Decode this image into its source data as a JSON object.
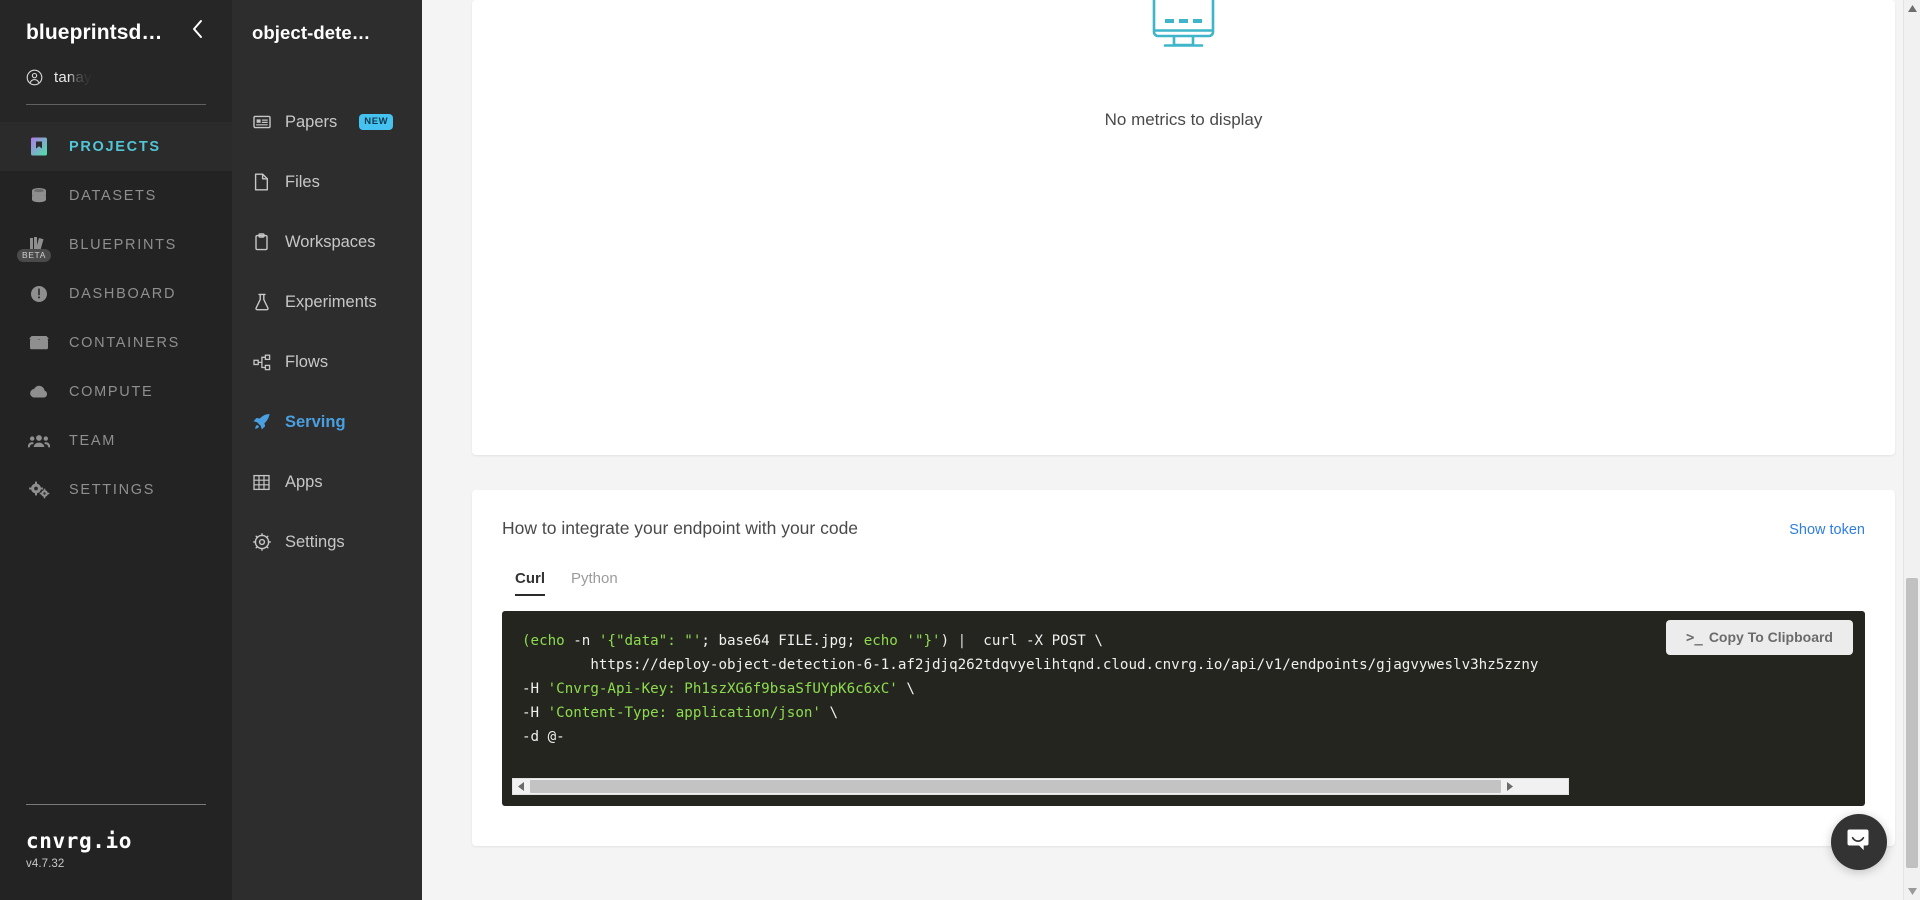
{
  "sidebar": {
    "org_name": "blueprintsd…",
    "collapse_icon": "chevron-left-icon",
    "user_name": "tanay.",
    "items": [
      {
        "label": "PROJECTS",
        "icon": "projects-icon",
        "active": true
      },
      {
        "label": "DATASETS",
        "icon": "datasets-icon",
        "active": false
      },
      {
        "label": "BLUEPRINTS",
        "icon": "blueprints-icon",
        "active": false,
        "badge": "BETA"
      },
      {
        "label": "DASHBOARD",
        "icon": "dashboard-icon",
        "active": false
      },
      {
        "label": "CONTAINERS",
        "icon": "containers-icon",
        "active": false
      },
      {
        "label": "COMPUTE",
        "icon": "compute-icon",
        "active": false
      },
      {
        "label": "TEAM",
        "icon": "team-icon",
        "active": false
      },
      {
        "label": "SETTINGS",
        "icon": "settings-icon",
        "active": false
      }
    ],
    "brand_name": "cnvrg.io",
    "brand_version": "v4.7.32",
    "accent_active": "#52c5d6"
  },
  "project_nav": {
    "title": "object-dete…",
    "items": [
      {
        "label": "Papers",
        "icon": "papers-icon",
        "active": false,
        "badge": "NEW"
      },
      {
        "label": "Files",
        "icon": "file-icon",
        "active": false
      },
      {
        "label": "Workspaces",
        "icon": "clipboard-icon",
        "active": false
      },
      {
        "label": "Experiments",
        "icon": "flask-icon",
        "active": false
      },
      {
        "label": "Flows",
        "icon": "flow-icon",
        "active": false
      },
      {
        "label": "Serving",
        "icon": "rocket-icon",
        "active": true
      },
      {
        "label": "Apps",
        "icon": "grid-icon",
        "active": false
      },
      {
        "label": "Settings",
        "icon": "gear-icon",
        "active": false
      }
    ],
    "accent_active": "#4a9fe0"
  },
  "metrics": {
    "empty_icon": "monitor-chart-icon",
    "empty_text": "No metrics to display",
    "icon_color": "#3eb5c9"
  },
  "integrate": {
    "title": "How to integrate your endpoint with your code",
    "show_token_label": "Show token",
    "show_token_color": "#2f7ee0",
    "tabs": [
      {
        "label": "Curl",
        "active": true
      },
      {
        "label": "Python",
        "active": false
      }
    ],
    "copy_button": {
      "label": "Copy To Clipboard",
      "prompt_glyph": ">_"
    },
    "code": {
      "language": "curl",
      "line1_a": "(echo",
      "line1_b": " -n ",
      "line1_c": "'{\"data\": \"'",
      "line1_d": "; base64 FILE.jpg; ",
      "line1_e": "echo",
      "line1_f": " '\"}'",
      "line1_g": ")",
      "line1_pipe": " |",
      "line1_curl": "  curl -X POST \\",
      "line2": "        https://deploy-object-detection-6-1.af2jdjq262tdqvyelihtqnd.cloud.cnvrg.io/api/v1/endpoints/gjagvyweslv3hz5zzny",
      "line3_flag": "-H ",
      "line3_val": "'Cnvrg-Api-Key: Ph1szXG6f9bsaSfUYpK6c6xC'",
      "line3_tail": " \\",
      "line4_flag": "-H ",
      "line4_val": "'Content-Type: application/json'",
      "line4_tail": " \\",
      "line5": "-d @-",
      "full_text": "(echo -n '{\"data\": \"'; base64 FILE.jpg; echo '\"}') |  curl -X POST \\\n        https://deploy-object-detection-6-1.af2jdjq262tdqvyelihtqnd.cloud.cnvrg.io/api/v1/endpoints/gjagvyweslv3hz5zzny \\\n-H 'Cnvrg-Api-Key: Ph1szXG6f9bsaSfUYpK6c6xC' \\\n-H 'Content-Type: application/json' \\\n-d @-",
      "bg": "#24251f",
      "string_color": "#8ddc4f"
    }
  },
  "chat": {
    "icon": "intercom-chat-icon"
  },
  "scrollbars": {
    "vertical_arrow_up": "caret-up-icon",
    "vertical_arrow_down": "caret-down-icon",
    "horizontal_arrow_left": "caret-left-icon",
    "horizontal_arrow_right": "caret-right-icon"
  }
}
